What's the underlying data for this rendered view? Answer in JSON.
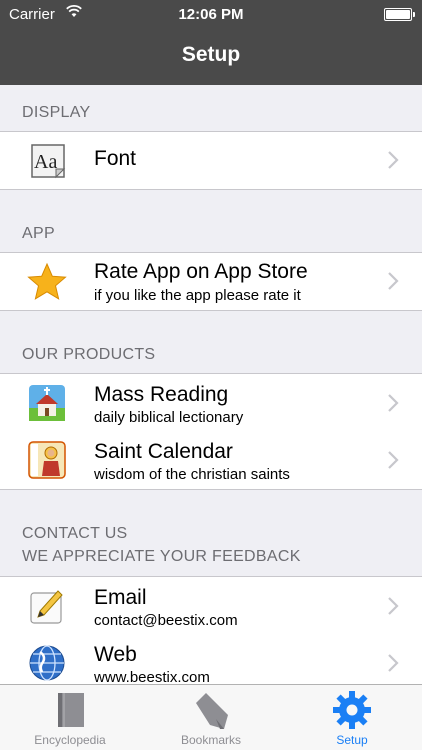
{
  "status": {
    "carrier": "Carrier",
    "time": "12:06 PM"
  },
  "nav": {
    "title": "Setup"
  },
  "sections": {
    "display": {
      "header": "DISPLAY",
      "rows": [
        {
          "title": "Font",
          "icon": "font-aa-icon"
        }
      ]
    },
    "app": {
      "header": "APP",
      "rows": [
        {
          "title": "Rate App on App Store",
          "subtitle": "if you like the app please rate it",
          "icon": "star-icon"
        }
      ]
    },
    "products": {
      "header": "OUR PRODUCTS",
      "rows": [
        {
          "title": "Mass Reading",
          "subtitle": "daily biblical lectionary",
          "icon": "church-app-icon"
        },
        {
          "title": "Saint Calendar",
          "subtitle": "wisdom of the christian saints",
          "icon": "saint-app-icon"
        }
      ]
    },
    "contact": {
      "header_line1": "CONTACT US",
      "header_line2": "WE APPRECIATE YOUR FEEDBACK",
      "rows": [
        {
          "title": "Email",
          "subtitle": "contact@beestix.com",
          "icon": "pencil-icon"
        },
        {
          "title": "Web",
          "subtitle": "www.beestix.com",
          "icon": "globe-icon"
        }
      ]
    }
  },
  "tabs": [
    {
      "label": "Encyclopedia",
      "icon": "book-icon",
      "active": false
    },
    {
      "label": "Bookmarks",
      "icon": "bookmark-icon",
      "active": false
    },
    {
      "label": "Setup",
      "icon": "gear-icon",
      "active": true
    }
  ],
  "colors": {
    "nav_bg": "#4a4a4a",
    "accent": "#1a7ff5",
    "page_bg": "#efeff4"
  }
}
